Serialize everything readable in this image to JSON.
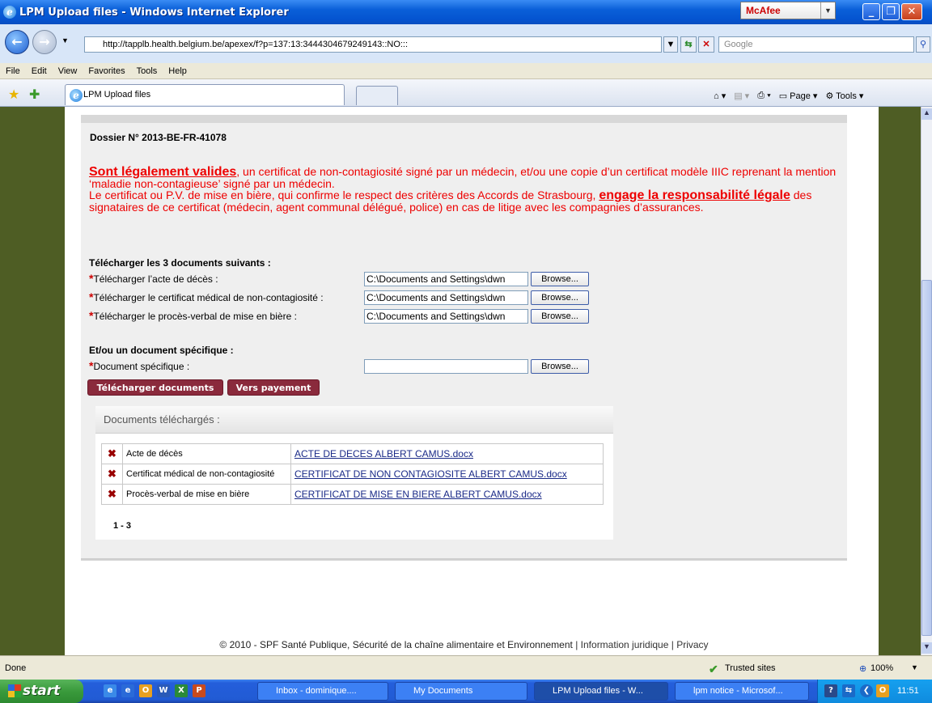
{
  "window": {
    "title": "LPM Upload files - Windows Internet Explorer",
    "mcafee": "McAfee"
  },
  "browser": {
    "address": "http://tapplb.health.belgium.be/apexex/f?p=137:13:3444304679249143::NO:::",
    "search_placeholder": "Google",
    "menu": [
      "File",
      "Edit",
      "View",
      "Favorites",
      "Tools",
      "Help"
    ],
    "tab_title": "LPM Upload files",
    "tools": {
      "page": "Page",
      "tools": "Tools"
    }
  },
  "page": {
    "dossier": "Dossier N° 2013-BE-FR-41078",
    "notice": {
      "p1_bold": "Sont légalement valides",
      "p1_rest": ", un certificat de non-contagiosité signé par un médecin, et/ou une copie d’un certificat modèle IIIC reprenant la mention ‘maladie non-contagieuse’ signé par un médecin.",
      "p2_start": "Le certificat ou P.V. de mise en bière, qui confirme le respect des critères des Accords de Strasbourg, ",
      "p2_bold": "engage la responsabilité légale",
      "p2_rest": " des signataires de ce certificat (médecin, agent communal délégué, police) en cas de litige avec les compagnies d’assurances."
    },
    "upload_heading": "Télécharger les 3 documents suivants :",
    "uploads": [
      {
        "label": "Télécharger l’acte de décès :",
        "value": "C:\\Documents and Settings\\dwn"
      },
      {
        "label": "Télécharger le certificat médical de non-contagiosité :",
        "value": "C:\\Documents and Settings\\dwn"
      },
      {
        "label": "Télécharger le procès-verbal de mise en bière :",
        "value": "C:\\Documents and Settings\\dwn"
      }
    ],
    "specific_heading": "Et/ou un document spécifique :",
    "specific_label": "Document spécifique :",
    "specific_value": "",
    "browse_label": "Browse...",
    "btn_upload": "Télécharger documents",
    "btn_payment": "Vers payement",
    "docs_heading": "Documents téléchargés :",
    "docs": [
      {
        "type": "Acte de décès",
        "file": "ACTE DE DECES ALBERT CAMUS.docx"
      },
      {
        "type": "Certificat médical de non-contagiosité",
        "file": "CERTIFICAT DE NON CONTAGIOSITE ALBERT CAMUS.docx"
      },
      {
        "type": "Procès-verbal de mise en bière",
        "file": "CERTIFICAT DE MISE EN BIERE ALBERT CAMUS.docx"
      }
    ],
    "pagination": "1 - 3",
    "footer": {
      "copyright": "© 2010 - SPF Santé Publique, Sécurité de la chaîne alimentaire et Environnement",
      "sep": "|",
      "legal": "Information juridique",
      "privacy": "Privacy"
    }
  },
  "status": {
    "text": "Done",
    "zone": "Trusted sites",
    "zoom": "100%"
  },
  "taskbar": {
    "start": "start",
    "items": [
      "Inbox - dominique....",
      "My Documents",
      "LPM Upload files - W...",
      "lpm notice - Microsof..."
    ],
    "clock": "11:51"
  }
}
